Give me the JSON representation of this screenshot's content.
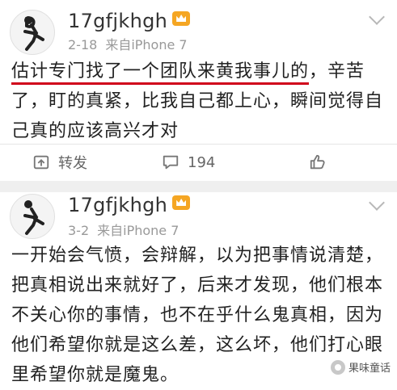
{
  "posts": [
    {
      "username": "17gfjkhgh",
      "date": "2-18",
      "source": "来自iPhone 7",
      "highlighted_text": "估计专门找了一个团队来黄我事儿的",
      "text": "，辛苦了，盯的真紧，比我自己都上心，瞬间觉得自己真的应该高兴才对",
      "actions": {
        "repost_label": "转发",
        "comment_count": "194",
        "like_count": ""
      }
    },
    {
      "username": "17gfjkhgh",
      "date": "3-2",
      "source": "来自iPhone 7",
      "text": "一开始会气愤，会辩解，以为把事情说清楚，把真相说出来就好了，后来才发现，他们根本不关心你的事情，也不在乎什么鬼真相，因为他们希望你就是这么差，这么坏，他们打心眼里希望你就是魔鬼。"
    }
  ],
  "watermark": {
    "text": "果味童话"
  },
  "colors": {
    "highlight_underline": "#d0021b",
    "vip_badge": "#f5a623"
  },
  "icons": {
    "avatar": "runner-silhouette",
    "badge": "vip-crown-icon",
    "menu": "chevron-down-icon",
    "repost": "repost-icon",
    "comment": "comment-icon",
    "like": "thumbs-up-icon"
  }
}
